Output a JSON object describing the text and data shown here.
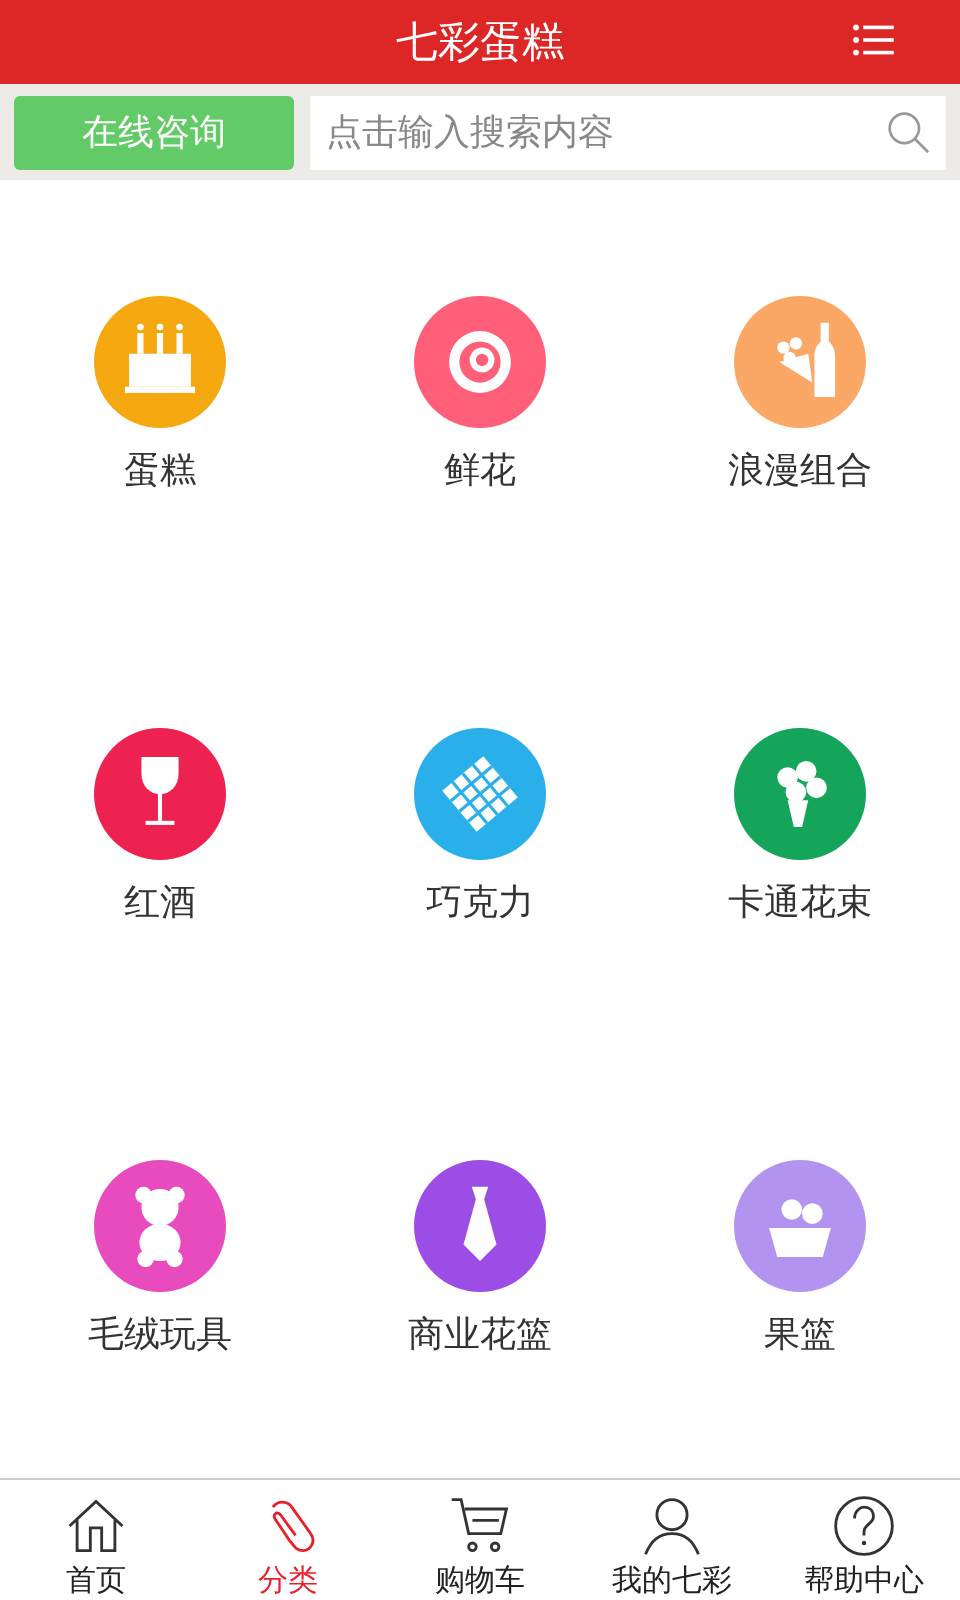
{
  "header": {
    "title": "七彩蛋糕"
  },
  "search_bar": {
    "consult_button": "在线咨询",
    "placeholder": "点击输入搜索内容"
  },
  "categories": [
    {
      "label": "蛋糕",
      "color": "#f5a80f"
    },
    {
      "label": "鲜花",
      "color": "#ff5f78"
    },
    {
      "label": "浪漫组合",
      "color": "#fba766"
    },
    {
      "label": "红酒",
      "color": "#ee2250"
    },
    {
      "label": "巧克力",
      "color": "#29b0ea"
    },
    {
      "label": "卡通花束",
      "color": "#14a55b"
    },
    {
      "label": "毛绒玩具",
      "color": "#e84bbd"
    },
    {
      "label": "商业花篮",
      "color": "#9b4de6"
    },
    {
      "label": "果篮",
      "color": "#b393f0"
    }
  ],
  "tab_bar": [
    {
      "label": "首页",
      "selected": false
    },
    {
      "label": "分类",
      "selected": true
    },
    {
      "label": "购物车",
      "selected": false
    },
    {
      "label": "我的七彩",
      "selected": false
    },
    {
      "label": "帮助中心",
      "selected": false
    }
  ]
}
